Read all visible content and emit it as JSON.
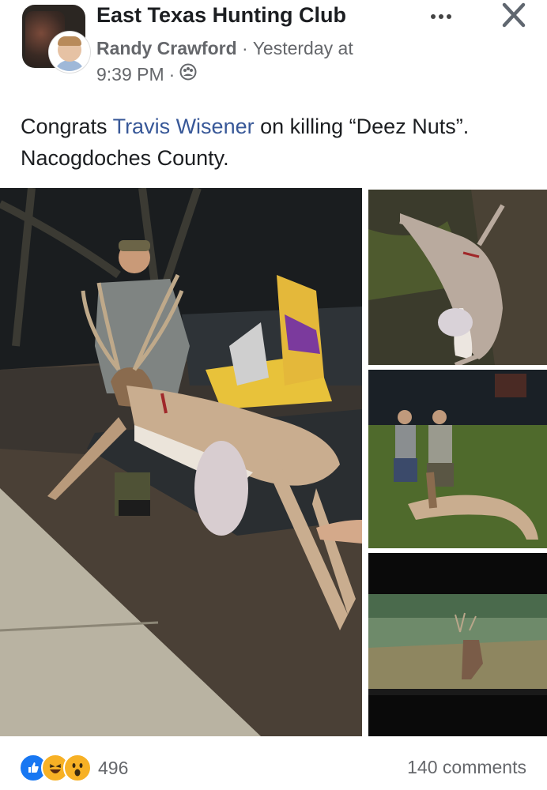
{
  "post": {
    "group_name": "East Texas Hunting Club",
    "author": "Randy Crawford",
    "separator": "·",
    "time_part1": "Yesterday at",
    "time_part2": "9:39 PM",
    "text_before": "Congrats ",
    "mention": "Travis Wisener",
    "text_after": " on killing “Deez Nuts”.  Nacogdoches County."
  },
  "icons": {
    "more": "more-options-icon",
    "close": "close-icon",
    "audience": "group-audience-icon"
  },
  "footer": {
    "reaction_count": "496",
    "comments": "140 comments"
  },
  "colors": {
    "mention": "#385898",
    "meta": "#65676b",
    "like": "#1877f2"
  }
}
